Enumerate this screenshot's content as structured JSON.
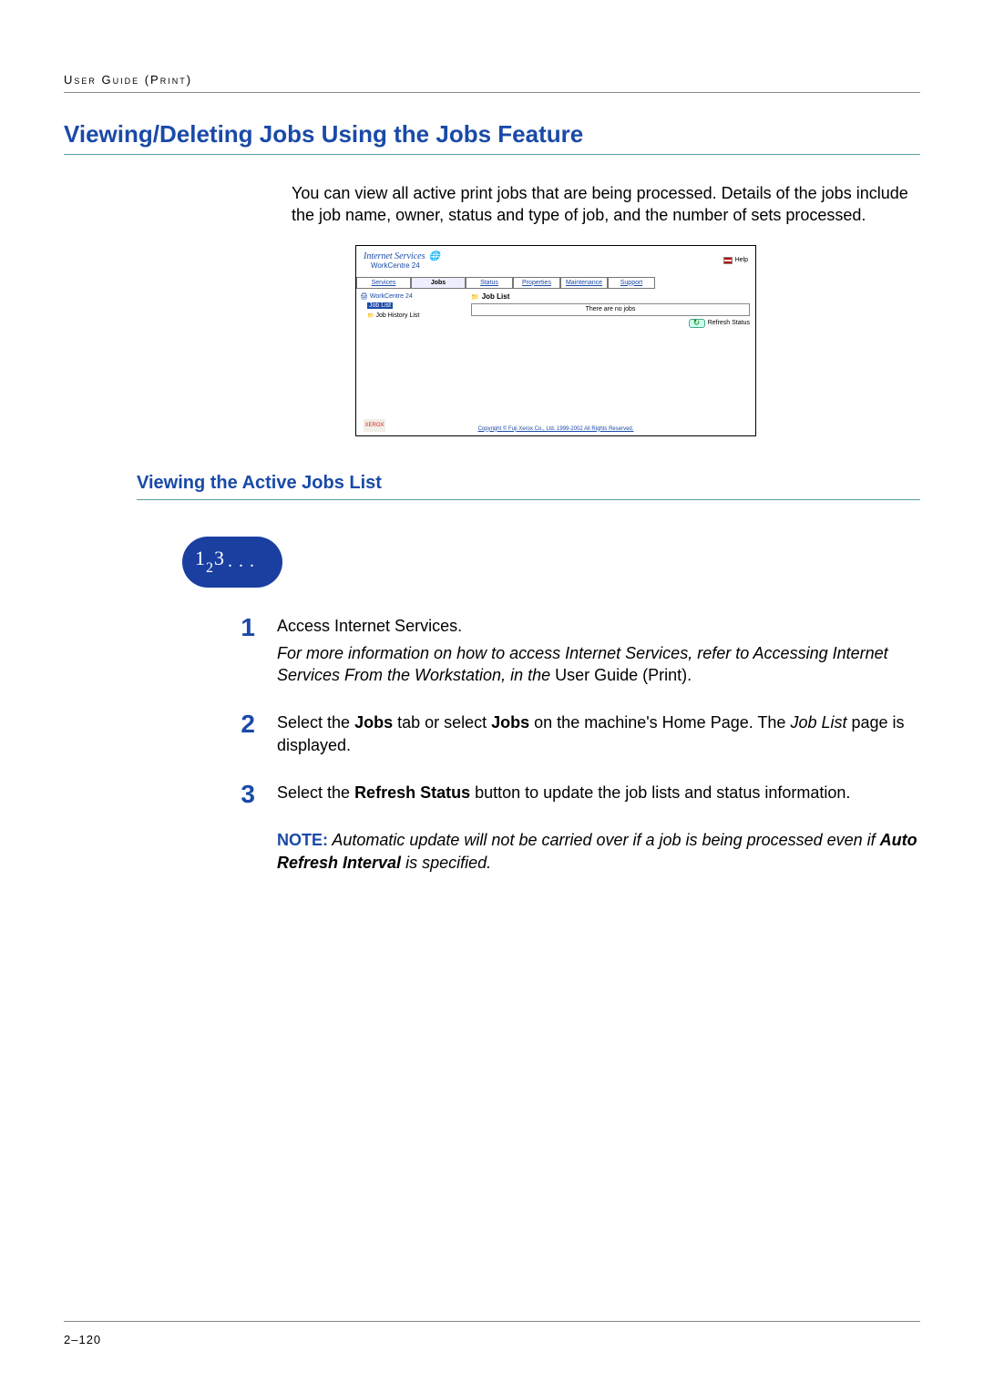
{
  "header": {
    "label": "User Guide (Print)"
  },
  "title": "Viewing/Deleting Jobs Using the Jobs Feature",
  "intro": "You can view all active print jobs that are being processed. Details of the jobs include the job name, owner, status and type of job, and the number of sets processed.",
  "screenshot": {
    "title": "Internet Services",
    "subtitle": "WorkCentre 24",
    "help": "Help",
    "tabs": {
      "services": "Services",
      "jobs": "Jobs",
      "status": "Status",
      "properties": "Properties",
      "maintenance": "Maintenance",
      "support": "Support"
    },
    "tree": {
      "root": "WorkCentre 24",
      "job_list": "Job List",
      "job_history": "Job History List"
    },
    "main": {
      "heading": "Job List",
      "empty": "There are no jobs",
      "refresh": "Refresh Status"
    },
    "footer": {
      "logo": "XEROX",
      "copyright": "Copyright © Fuji Xerox Co., Ltd. 1999-2002 All Rights Reserved."
    }
  },
  "subheading": "Viewing the Active Jobs List",
  "badge": "123...",
  "steps": [
    {
      "num": "1",
      "line1": "Access Internet Services.",
      "ital_a": "For more information on how to access Internet Services, refer to Accessing Internet Services From the Workstation, in the ",
      "ital_trail": "User Guide (Print)."
    },
    {
      "num": "2",
      "pre": "Select the ",
      "b1": "Jobs",
      "mid": " tab or select ",
      "b2": "Jobs",
      "post": " on the machine's Home Page. The ",
      "ital": "Job List",
      "tail": " page is displayed."
    },
    {
      "num": "3",
      "pre": "Select the ",
      "b1": "Refresh Status",
      "post": " button to update the job lists and status information."
    }
  ],
  "note": {
    "label": "NOTE:",
    "ital_a": " Automatic update will not be carried over if a job is being processed even if ",
    "bold": "Auto Refresh Interval",
    "ital_b": " is specified."
  },
  "page_number": "2–120"
}
